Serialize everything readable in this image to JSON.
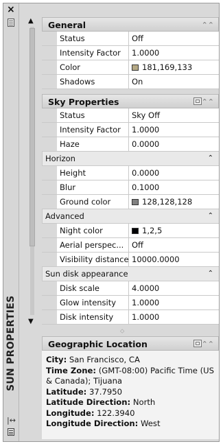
{
  "palette_title": "SUN PROPERTIES",
  "sections": {
    "general": {
      "title": "General",
      "rows": [
        {
          "label": "Status",
          "value": "Off"
        },
        {
          "label": "Intensity Factor",
          "value": "1.0000"
        },
        {
          "label": "Color",
          "value": "181,169,133",
          "swatch": "#b5a985"
        },
        {
          "label": "Shadows",
          "value": "On"
        }
      ]
    },
    "sky": {
      "title": "Sky Properties",
      "rows": [
        {
          "label": "Status",
          "value": "Sky Off"
        },
        {
          "label": "Intensity Factor",
          "value": "1.0000"
        },
        {
          "label": "Haze",
          "value": "0.0000"
        }
      ],
      "horizon": {
        "title": "Horizon",
        "rows": [
          {
            "label": "Height",
            "value": "0.0000"
          },
          {
            "label": "Blur",
            "value": "0.1000"
          },
          {
            "label": "Ground color",
            "value": "128,128,128",
            "swatch": "#808080"
          }
        ]
      },
      "advanced": {
        "title": "Advanced",
        "rows": [
          {
            "label": "Night color",
            "value": "1,2,5",
            "swatch": "#010205"
          },
          {
            "label": "Aerial perspec...",
            "value": "Off"
          },
          {
            "label": "Visibility distance",
            "value": "10000.0000"
          }
        ]
      },
      "sun_disk": {
        "title": "Sun disk appearance",
        "rows": [
          {
            "label": "Disk scale",
            "value": "4.0000"
          },
          {
            "label": "Glow intensity",
            "value": "1.0000"
          },
          {
            "label": "Disk intensity",
            "value": "1.0000"
          }
        ]
      }
    },
    "geo": {
      "title": "Geographic Location",
      "fields": [
        {
          "label": "City:",
          "value": "San Francisco, CA"
        },
        {
          "label": "Time Zone:",
          "value": "(GMT-08:00) Pacific Time (US & Canada); Tijuana"
        },
        {
          "label": "Latitude:",
          "value": "37.7950"
        },
        {
          "label": "Latitude Direction:",
          "value": "North"
        },
        {
          "label": "Longitude:",
          "value": "122.3940"
        },
        {
          "label": "Longitude Direction:",
          "value": "West"
        }
      ]
    }
  }
}
